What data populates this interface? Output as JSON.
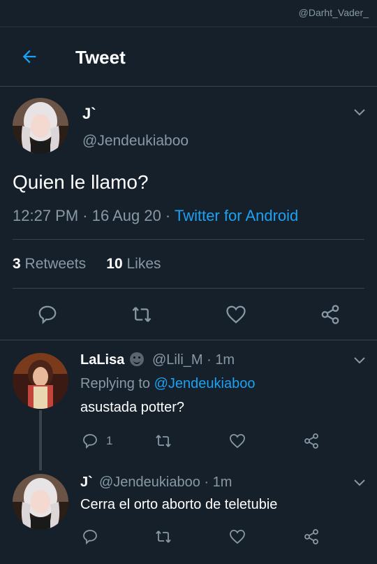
{
  "watermark": "@Darht_Vader_",
  "header": {
    "title": "Tweet"
  },
  "tweet": {
    "display_name": "J`",
    "handle": "@Jendeukiaboo",
    "text": "Quien le llamo?",
    "time": "12:27 PM · 16 Aug 20 · ",
    "client": "Twitter for Android",
    "retweets_count": "3",
    "retweets_label": "Retweets",
    "likes_count": "10",
    "likes_label": "Likes"
  },
  "replies": [
    {
      "display_name": "LaLisa",
      "handle_time": "@Lili_M · 1m",
      "replying_prefix": "Replying to ",
      "replying_to": "@Jendeukiaboo",
      "text": "asustada potter?",
      "reply_count": "1"
    },
    {
      "display_name": "J`",
      "handle_time": "@Jendeukiaboo · 1m",
      "text": "Cerra el orto aborto de teletubie"
    }
  ],
  "colors": {
    "background": "#15202b",
    "accent": "#1da1f2",
    "muted": "#8899a6",
    "divider": "#38444d"
  },
  "icons": [
    "back-arrow-icon",
    "chevron-down-icon",
    "reply-icon",
    "retweet-icon",
    "like-icon",
    "share-icon",
    "smiley-emoji-icon"
  ]
}
